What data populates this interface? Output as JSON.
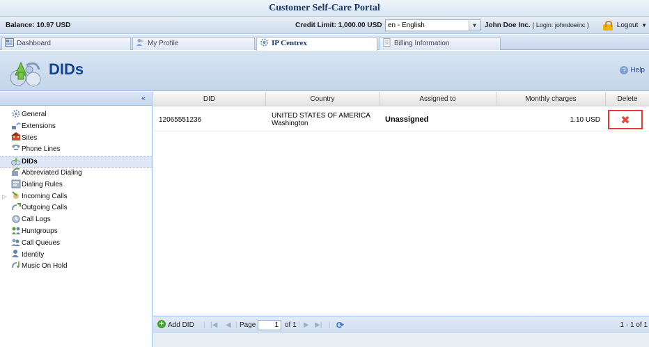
{
  "portal": {
    "title": "Customer Self-Care Portal"
  },
  "info_bar": {
    "balance": "Balance: 10.97 USD",
    "credit_limit": "Credit Limit: 1,000.00 USD",
    "language": "en - English",
    "company": "John Doe Inc.",
    "login": "( Login: johndoeinc )",
    "logout": "Logout"
  },
  "tabs": [
    {
      "label": "Dashboard",
      "icon": "dashboard-icon"
    },
    {
      "label": "My Profile",
      "icon": "profile-icon"
    },
    {
      "label": "IP Centrex",
      "icon": "gear-icon",
      "active": true
    },
    {
      "label": "Billing Information",
      "icon": "billing-icon"
    }
  ],
  "page": {
    "title": "DIDs",
    "help": "Help"
  },
  "sidebar": {
    "items": [
      {
        "label": "General",
        "icon": "general-icon"
      },
      {
        "label": "Extensions",
        "icon": "extensions-icon"
      },
      {
        "label": "Sites",
        "icon": "sites-icon"
      },
      {
        "label": "Phone Lines",
        "icon": "phone-lines-icon"
      },
      {
        "label": "DIDs",
        "icon": "dids-icon",
        "selected": true
      },
      {
        "label": "Abbreviated Dialing",
        "icon": "abbreviated-dialing-icon"
      },
      {
        "label": "Dialing Rules",
        "icon": "dialing-rules-icon"
      },
      {
        "label": "Incoming Calls",
        "icon": "incoming-calls-icon"
      },
      {
        "label": "Outgoing Calls",
        "icon": "outgoing-calls-icon"
      },
      {
        "label": "Call Logs",
        "icon": "call-logs-icon"
      },
      {
        "label": "Huntgroups",
        "icon": "huntgroups-icon"
      },
      {
        "label": "Call Queues",
        "icon": "call-queues-icon"
      },
      {
        "label": "Identity",
        "icon": "identity-icon"
      },
      {
        "label": "Music On Hold",
        "icon": "music-on-hold-icon"
      }
    ]
  },
  "grid": {
    "columns": [
      "DID",
      "Country",
      "Assigned to",
      "Monthly charges",
      "Delete"
    ],
    "rows": [
      {
        "did": "12065551236",
        "country": "UNITED STATES OF AMERICA",
        "region": "Washington",
        "assigned_to": "Unassigned",
        "monthly_charges": "1.10 USD"
      }
    ]
  },
  "pager": {
    "add_label": "Add DID",
    "page_label": "Page",
    "page_value": "1",
    "of_label": "of 1",
    "range": "1 - 1 of 1"
  },
  "colors": {
    "accent": "#15428b",
    "delete_highlight": "#e33b3b",
    "selected_row": "#dfe8f6"
  }
}
